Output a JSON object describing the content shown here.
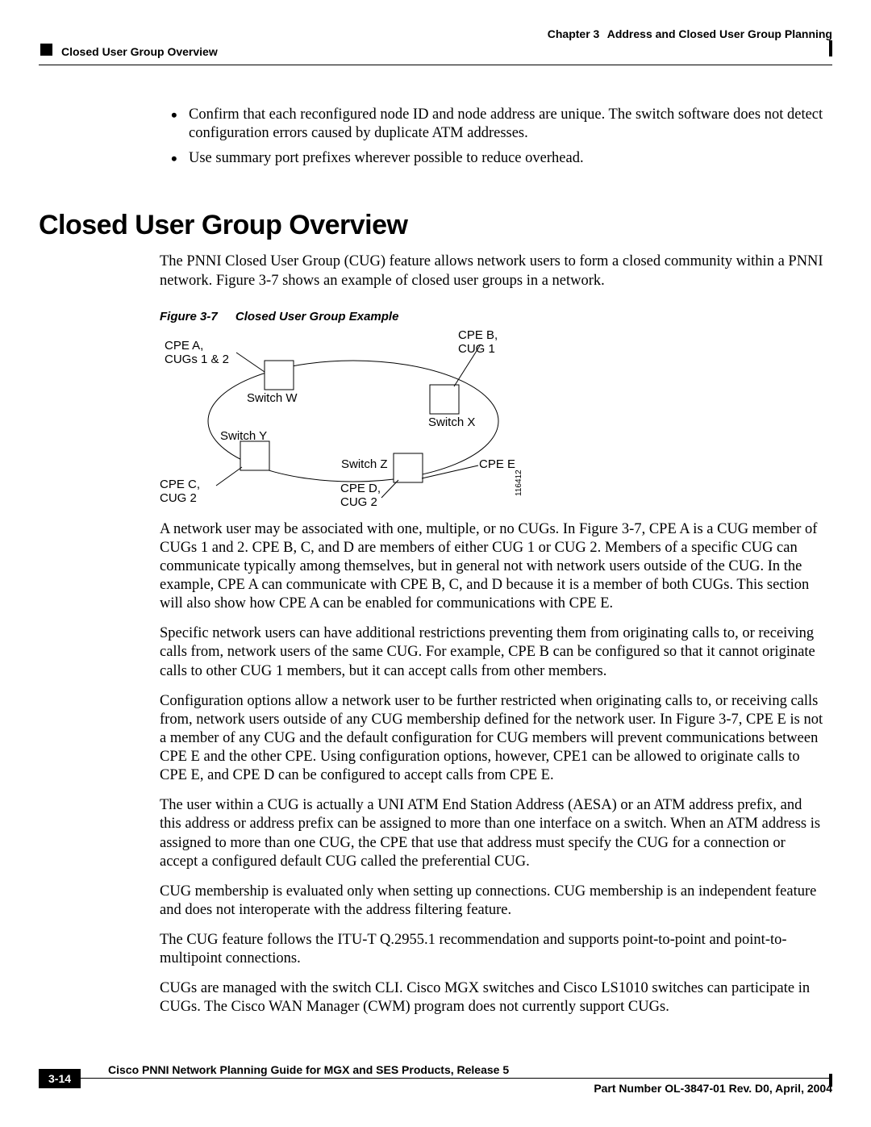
{
  "header": {
    "chapter_prefix": "Chapter 3",
    "chapter_title": "Address and Closed User Group Planning",
    "section_small": "Closed User Group Overview"
  },
  "bullets": {
    "item1": "Confirm that each reconfigured node ID and node address are unique. The switch software does not detect configuration errors caused by duplicate ATM addresses.",
    "item2": "Use summary port prefixes wherever possible to reduce overhead."
  },
  "heading": "Closed User Group Overview",
  "intro": {
    "before_link": "The PNNI Closed User Group (CUG) feature allows network users to form a closed community within a PNNI network. ",
    "link": "Figure 3-7",
    "after_link": " shows an example of closed user groups in a network."
  },
  "figure": {
    "number": "Figure 3-7",
    "title": "Closed User Group Example",
    "labels": {
      "cpe_a": "CPE A,\nCUGs 1 & 2",
      "cpe_b": "CPE B,\nCUG 1",
      "cpe_c": "CPE C,\nCUG 2",
      "cpe_d": "CPE D,\nCUG 2",
      "cpe_e": "CPE E",
      "switch_w": "Switch W",
      "switch_x": "Switch X",
      "switch_y": "Switch Y",
      "switch_z": "Switch Z",
      "side_number": "116412"
    }
  },
  "paragraphs": {
    "p1_before": "A network user may be associated with one, multiple, or no CUGs. In ",
    "p1_link": "Figure 3-7",
    "p1_after": ", CPE A is a CUG member of CUGs 1 and 2. CPE B, C, and D are members of either CUG 1 or CUG 2. Members of a specific CUG can communicate typically among themselves, but in general not with network users outside of the CUG. In the example, CPE A can communicate with CPE B, C, and D because it is a member of both CUGs. This section will also show how CPE A can be enabled for communications with CPE E.",
    "p2": "Specific network users can have additional restrictions preventing them from originating calls to, or receiving calls from, network users of the same CUG. For example, CPE B can be configured so that it cannot originate calls to other CUG 1 members, but it can accept calls from other members.",
    "p3_before": "Configuration options allow a network user to be further restricted when originating calls to, or receiving calls from, network users outside of any CUG membership defined for the network user. In ",
    "p3_link": "Figure 3-7",
    "p3_after": ", CPE E is not a member of any CUG and the default configuration for CUG members will prevent communications between CPE E and the other CPE. Using configuration options, however, CPE1 can be allowed to originate calls to CPE E, and CPE D can be configured to accept calls from CPE E.",
    "p4": "The user within a CUG is actually a UNI ATM End Station Address (AESA) or an ATM address prefix, and this address or address prefix can be assigned to more than one interface on a switch. When an ATM address is assigned to more than one CUG, the CPE that use that address must specify the CUG for a connection or accept a configured default CUG called the preferential CUG.",
    "p5": "CUG membership is evaluated only when setting up connections. CUG membership is an independent feature and does not interoperate with the address filtering feature.",
    "p6": "The CUG feature follows the ITU-T Q.2955.1 recommendation and supports point-to-point and point-to-multipoint connections.",
    "p7": "CUGs are managed with the switch CLI. Cisco MGX switches and Cisco LS1010 switches can participate in CUGs. The Cisco WAN Manager (CWM) program does not currently support CUGs."
  },
  "footer": {
    "title": "Cisco PNNI Network Planning Guide  for MGX and SES Products, Release 5",
    "page_number": "3-14",
    "part_number": "Part Number OL-3847-01 Rev. D0, April, 2004"
  }
}
